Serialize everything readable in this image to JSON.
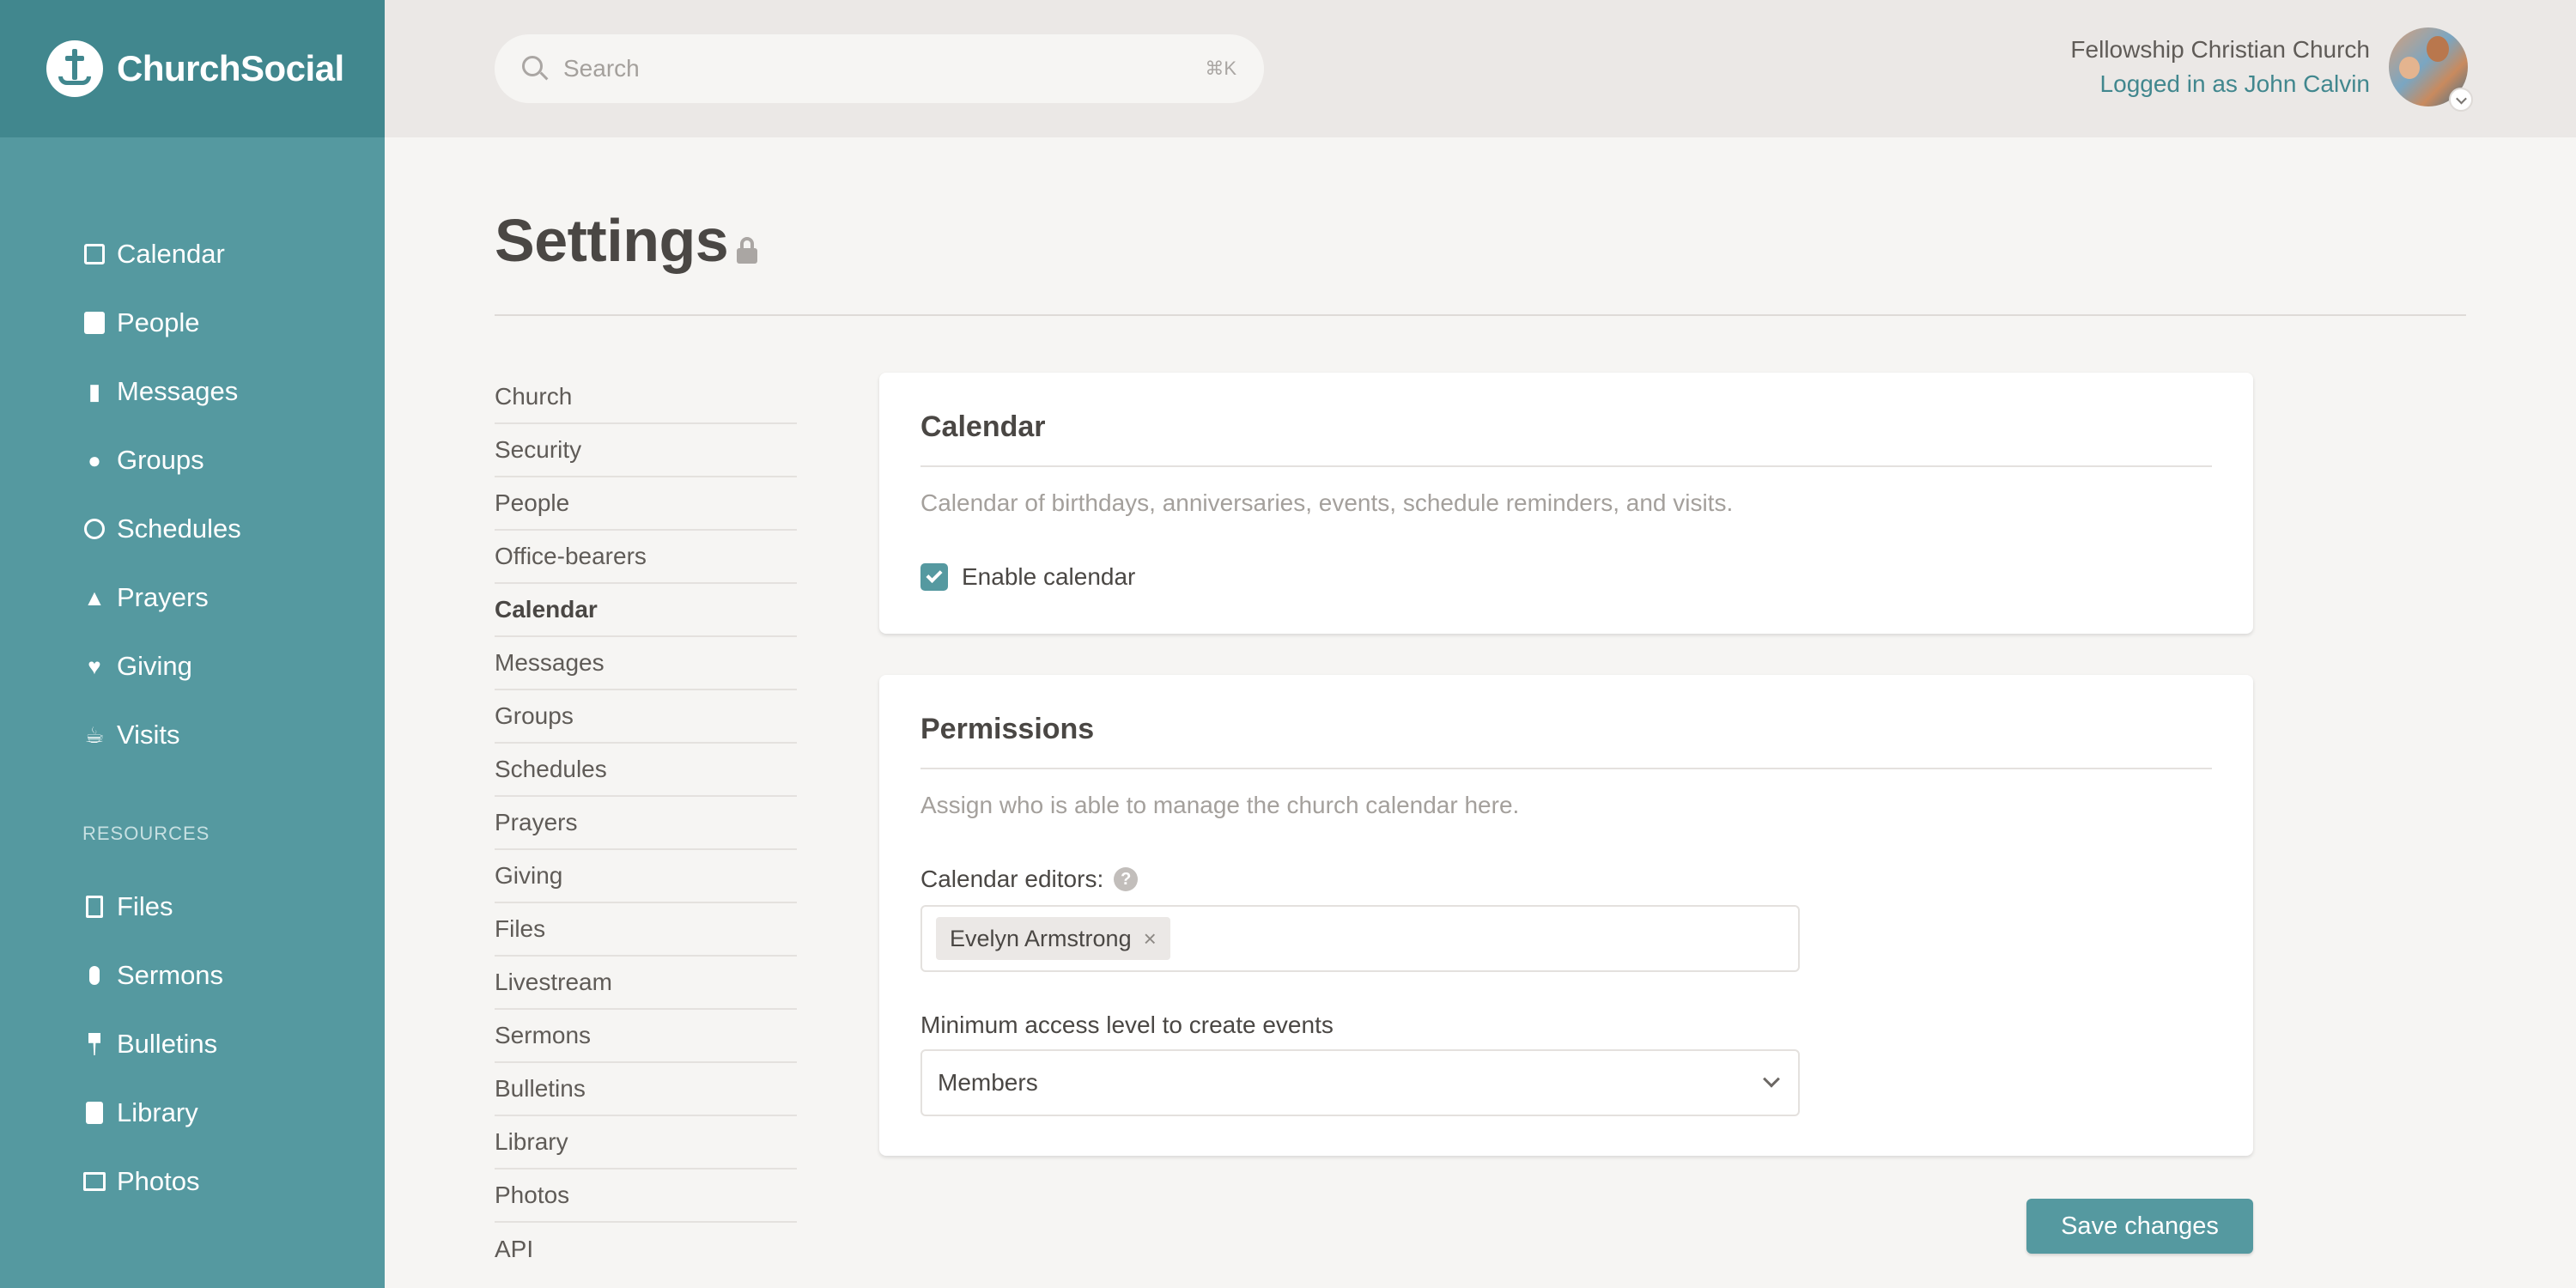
{
  "brand": {
    "name": "ChurchSocial",
    "logo_icon": "cross-logo-icon"
  },
  "sidebar": {
    "items": [
      {
        "label": "Calendar",
        "icon": "calendar-icon"
      },
      {
        "label": "People",
        "icon": "contact-card-icon"
      },
      {
        "label": "Messages",
        "icon": "chat-bubbles-icon"
      },
      {
        "label": "Groups",
        "icon": "users-icon"
      },
      {
        "label": "Schedules",
        "icon": "clock-icon"
      },
      {
        "label": "Prayers",
        "icon": "praying-hands-icon"
      },
      {
        "label": "Giving",
        "icon": "heart-icon"
      },
      {
        "label": "Visits",
        "icon": "coffee-cup-icon"
      }
    ],
    "resources_label": "RESOURCES",
    "resources": [
      {
        "label": "Files",
        "icon": "file-icon"
      },
      {
        "label": "Sermons",
        "icon": "microphone-icon"
      },
      {
        "label": "Bulletins",
        "icon": "pushpin-icon"
      },
      {
        "label": "Library",
        "icon": "book-icon"
      },
      {
        "label": "Photos",
        "icon": "image-icon"
      }
    ]
  },
  "header": {
    "search_placeholder": "Search",
    "search_shortcut": "⌘K",
    "church_name": "Fellowship Christian Church",
    "logged_in": "Logged in as John Calvin"
  },
  "page": {
    "title": "Settings"
  },
  "settings_nav": {
    "items": [
      "Church",
      "Security",
      "People",
      "Office-bearers",
      "Calendar",
      "Messages",
      "Groups",
      "Schedules",
      "Prayers",
      "Giving",
      "Files",
      "Livestream",
      "Sermons",
      "Bulletins",
      "Library",
      "Photos",
      "API"
    ],
    "active": "Calendar"
  },
  "calendar_card": {
    "title": "Calendar",
    "description": "Calendar of birthdays, anniversaries, events, schedule reminders, and visits.",
    "enable_label": "Enable calendar",
    "enabled": true
  },
  "permissions_card": {
    "title": "Permissions",
    "description": "Assign who is able to manage the church calendar here.",
    "editors_label": "Calendar editors:",
    "editors": [
      "Evelyn Armstrong"
    ],
    "min_access_label": "Minimum access level to create events",
    "min_access_value": "Members"
  },
  "actions": {
    "save_label": "Save changes"
  },
  "colors": {
    "accent": "#5599a0",
    "sidebar_dark": "#41878e",
    "topbar": "#ebe8e6",
    "background": "#f6f5f3"
  }
}
